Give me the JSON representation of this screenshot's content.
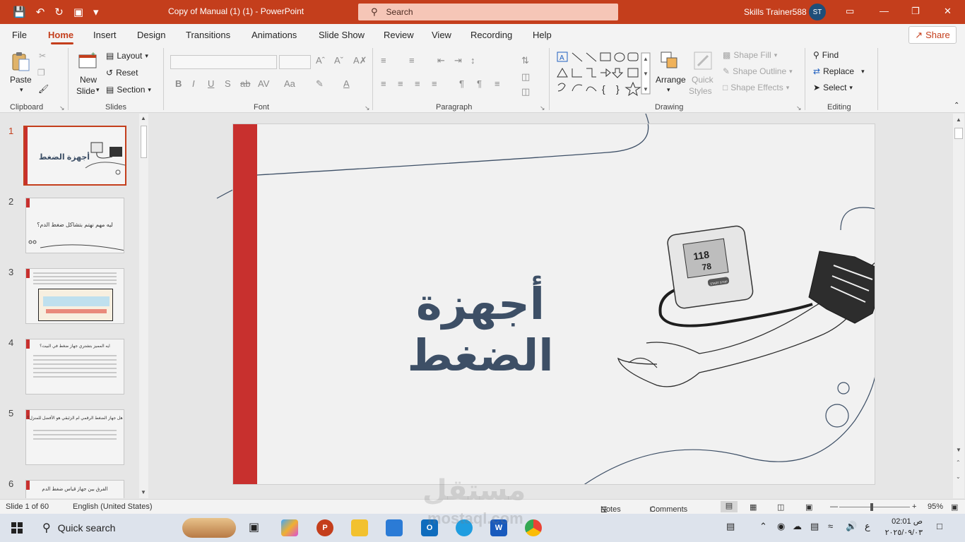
{
  "title_bar": {
    "doc_title": "Copy of Manual (1) (1)  -  PowerPoint",
    "search_placeholder": "Search",
    "user_name": "Skills Trainer588",
    "user_initials": "ST"
  },
  "tabs": [
    "File",
    "Home",
    "Insert",
    "Design",
    "Transitions",
    "Animations",
    "Slide Show",
    "Review",
    "View",
    "Recording",
    "Help"
  ],
  "active_tab": "Home",
  "share_label": "Share",
  "ribbon": {
    "clipboard": {
      "label": "Clipboard",
      "paste": "Paste"
    },
    "slides": {
      "label": "Slides",
      "new_slide_1": "New",
      "new_slide_2": "Slide",
      "layout": "Layout",
      "reset": "Reset",
      "section": "Section"
    },
    "font": {
      "label": "Font"
    },
    "paragraph": {
      "label": "Paragraph"
    },
    "drawing": {
      "label": "Drawing",
      "arrange": "Arrange",
      "quick_styles_1": "Quick",
      "quick_styles_2": "Styles",
      "shape_fill": "Shape Fill",
      "shape_outline": "Shape Outline",
      "shape_effects": "Shape Effects"
    },
    "editing": {
      "label": "Editing",
      "find": "Find",
      "replace": "Replace",
      "select": "Select"
    }
  },
  "thumbnails": [
    {
      "num": "1",
      "text": "أجهزة الضغط"
    },
    {
      "num": "2",
      "text": "ليه مهم نهتم بتشاكل ضغط الدم؟"
    },
    {
      "num": "3",
      "text": ""
    },
    {
      "num": "4",
      "text": "ايه المميز بتشتري جهاز ضغط في البيت؟"
    },
    {
      "num": "5",
      "text": "هل جهاز الضغط الرقمي ام الزئبقي هو الأفضل للمنزل؟"
    },
    {
      "num": "6",
      "text": "الفرق بين جهاز قياس ضغط الدم"
    }
  ],
  "slide": {
    "title": "أجهزة الضغط",
    "device_reading": "118",
    "device_reading2": "78",
    "start_label": "START STOP"
  },
  "status": {
    "slide_info": "Slide 1 of 60",
    "language": "English (United States)",
    "notes": "Notes",
    "comments": "Comments",
    "zoom": "95%"
  },
  "taskbar": {
    "search": "Quick search",
    "time": "02:01 ص",
    "date": "٢٠٢٥/٠٩/٠٣",
    "lang": "ع"
  },
  "watermark": {
    "line1": "مستقل",
    "line2": "mostaql.com"
  },
  "colors": {
    "accent": "#c43e1c",
    "slide_bar": "#c8302e",
    "title_text": "#3d4f66"
  }
}
